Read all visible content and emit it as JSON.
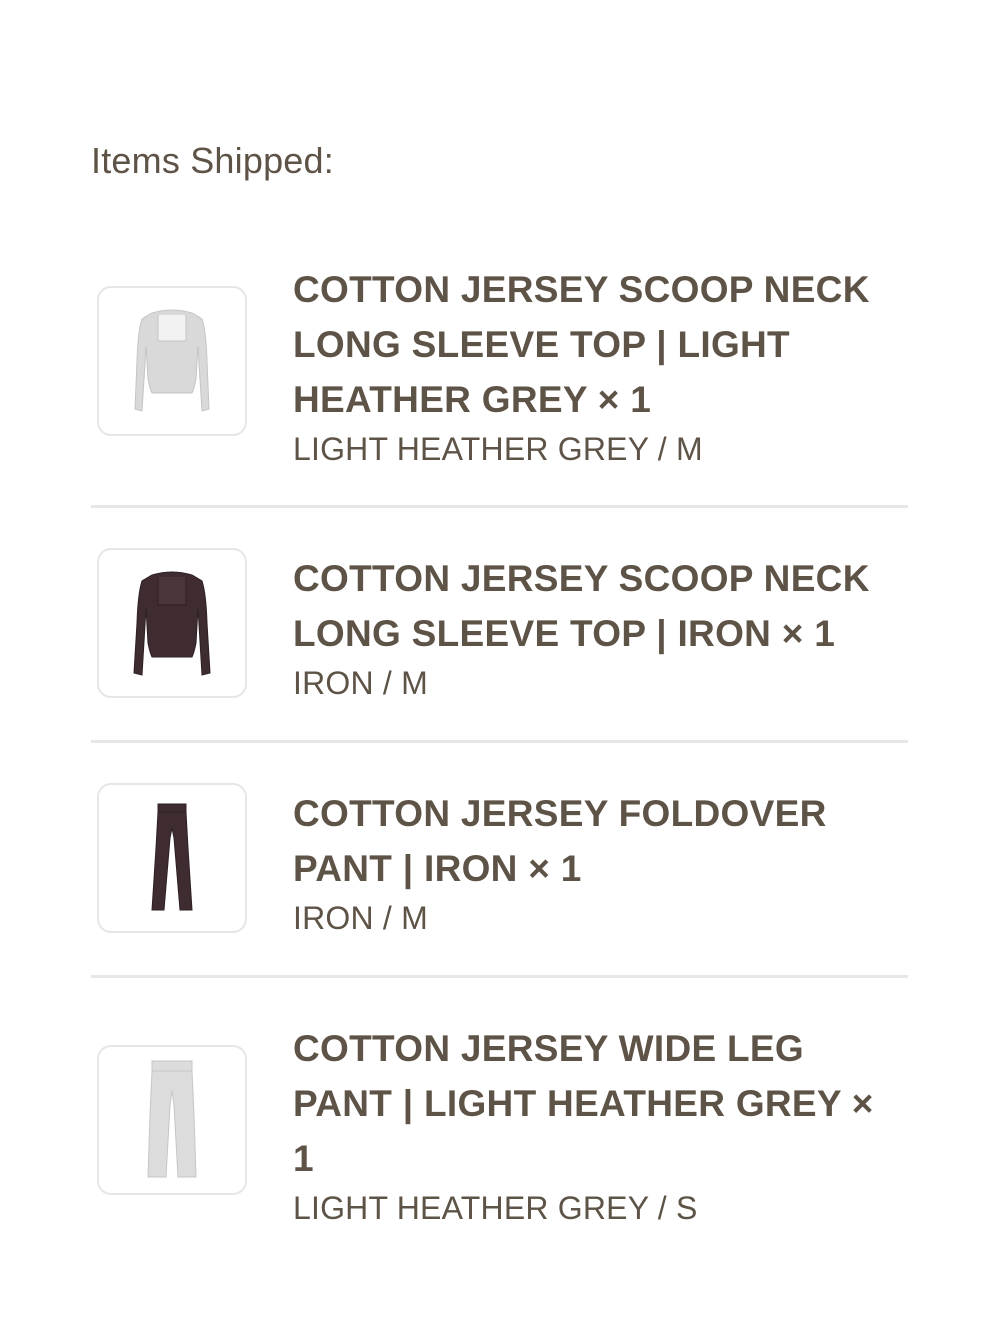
{
  "section": {
    "heading": "Items Shipped:"
  },
  "items": [
    {
      "title": "COTTON JERSEY SCOOP NECK LONG SLEEVE TOP | LIGHT HEATHER GREY × 1",
      "variant": "LIGHT HEATHER GREY / M",
      "thumbnail": "long-sleeve-top-light-grey-icon",
      "color": "#d9d9d9"
    },
    {
      "title": "COTTON JERSEY SCOOP NECK LONG SLEEVE TOP | IRON × 1",
      "variant": "IRON / M",
      "thumbnail": "long-sleeve-top-iron-icon",
      "color": "#3f2c30"
    },
    {
      "title": "COTTON JERSEY FOLDOVER PANT | IRON × 1",
      "variant": "IRON / M",
      "thumbnail": "foldover-pant-iron-icon",
      "color": "#3f2c30"
    },
    {
      "title": "COTTON JERSEY WIDE LEG PANT | LIGHT HEATHER GREY × 1",
      "variant": "LIGHT HEATHER GREY / S",
      "thumbnail": "wide-leg-pant-light-grey-icon",
      "color": "#dcdcdc"
    }
  ]
}
